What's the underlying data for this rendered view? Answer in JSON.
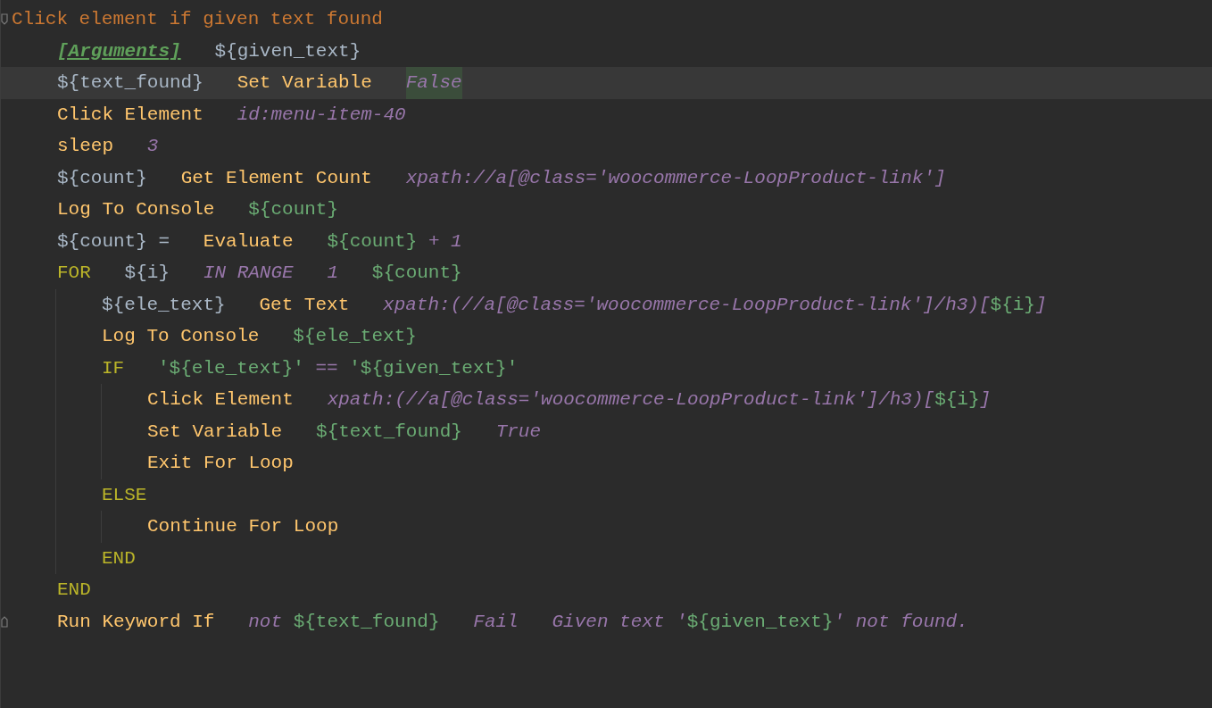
{
  "keyword": {
    "name": "Click element if given text found",
    "fold_start": true,
    "steps": [
      {
        "cells": [
          [
            {
              "kind": "setting",
              "text": "[Arguments]"
            }
          ],
          [
            {
              "kind": "variable",
              "text": "${given_text}"
            }
          ]
        ]
      },
      {
        "current": true,
        "cells": [
          [
            {
              "kind": "variable",
              "text": "${text_found}"
            }
          ],
          [
            {
              "kind": "keyword",
              "text": "Set Variable"
            }
          ],
          [
            {
              "kind": "arg",
              "text": "False",
              "highlighted": true
            }
          ]
        ]
      },
      {
        "cells": [
          [
            {
              "kind": "keyword",
              "text": "Click Element"
            }
          ],
          [
            {
              "kind": "arg",
              "text": "id:menu-item-40"
            }
          ]
        ]
      },
      {
        "cells": [
          [
            {
              "kind": "keyword",
              "text": "sleep"
            }
          ],
          [
            {
              "kind": "arg",
              "text": "3"
            }
          ]
        ]
      },
      {
        "cells": [
          [
            {
              "kind": "variable",
              "text": "${count}"
            }
          ],
          [
            {
              "kind": "keyword",
              "text": "Get Element Count"
            }
          ],
          [
            {
              "kind": "arg",
              "text": "xpath://a[@class='woocommerce-LoopProduct-link']"
            }
          ]
        ]
      },
      {
        "cells": [
          [
            {
              "kind": "keyword",
              "text": "Log To Console"
            }
          ],
          [
            {
              "kind": "var",
              "text": "${count}"
            }
          ]
        ]
      },
      {
        "cells": [
          [
            {
              "kind": "variable",
              "text": "${count} ="
            }
          ],
          [
            {
              "kind": "keyword",
              "text": "Evaluate"
            }
          ],
          [
            {
              "kind": "var",
              "text": "${count}"
            },
            {
              "kind": "arg",
              "text": " + 1"
            }
          ]
        ]
      },
      {
        "cells": [
          [
            {
              "kind": "control",
              "text": "FOR"
            }
          ],
          [
            {
              "kind": "variable",
              "text": "${i}"
            }
          ],
          [
            {
              "kind": "arg",
              "text": "IN RANGE"
            }
          ],
          [
            {
              "kind": "arg",
              "text": "1"
            }
          ],
          [
            {
              "kind": "var",
              "text": "${count}"
            }
          ]
        ],
        "children": [
          {
            "cells": [
              [
                {
                  "kind": "variable",
                  "text": "${ele_text}"
                }
              ],
              [
                {
                  "kind": "keyword",
                  "text": "Get Text"
                }
              ],
              [
                {
                  "kind": "arg",
                  "text": "xpath:(//a[@class='woocommerce-LoopProduct-link']/h3)["
                },
                {
                  "kind": "var",
                  "text": "${i}"
                },
                {
                  "kind": "arg",
                  "text": "]"
                }
              ]
            ]
          },
          {
            "cells": [
              [
                {
                  "kind": "keyword",
                  "text": "Log To Console"
                }
              ],
              [
                {
                  "kind": "var",
                  "text": "${ele_text}"
                }
              ]
            ]
          },
          {
            "cells": [
              [
                {
                  "kind": "control",
                  "text": "IF"
                }
              ],
              [
                {
                  "kind": "var",
                  "text": "'${ele_text}'"
                },
                {
                  "kind": "arg",
                  "text": " == "
                },
                {
                  "kind": "var",
                  "text": "'${given_text}'"
                }
              ]
            ],
            "children": [
              {
                "cells": [
                  [
                    {
                      "kind": "keyword",
                      "text": "Click Element"
                    }
                  ],
                  [
                    {
                      "kind": "arg",
                      "text": "xpath:(//a[@class='woocommerce-LoopProduct-link']/h3)["
                    },
                    {
                      "kind": "var",
                      "text": "${i}"
                    },
                    {
                      "kind": "arg",
                      "text": "]"
                    }
                  ]
                ]
              },
              {
                "cells": [
                  [
                    {
                      "kind": "keyword",
                      "text": "Set Variable"
                    }
                  ],
                  [
                    {
                      "kind": "var",
                      "text": "${text_found}"
                    }
                  ],
                  [
                    {
                      "kind": "arg",
                      "text": "True"
                    }
                  ]
                ]
              },
              {
                "cells": [
                  [
                    {
                      "kind": "keyword",
                      "text": "Exit For Loop"
                    }
                  ]
                ]
              }
            ]
          },
          {
            "cells": [
              [
                {
                  "kind": "control",
                  "text": "ELSE"
                }
              ]
            ],
            "children": [
              {
                "cells": [
                  [
                    {
                      "kind": "keyword",
                      "text": "Continue For Loop"
                    }
                  ]
                ]
              }
            ]
          },
          {
            "cells": [
              [
                {
                  "kind": "control",
                  "text": "END"
                }
              ]
            ]
          }
        ]
      },
      {
        "cells": [
          [
            {
              "kind": "control",
              "text": "END"
            }
          ]
        ]
      },
      {
        "fold_end": true,
        "cells": [
          [
            {
              "kind": "keyword",
              "text": "Run Keyword If"
            }
          ],
          [
            {
              "kind": "arg",
              "text": "not "
            },
            {
              "kind": "var",
              "text": "${text_found}"
            }
          ],
          [
            {
              "kind": "arg",
              "text": "Fail"
            }
          ],
          [
            {
              "kind": "arg",
              "text": "Given text '"
            },
            {
              "kind": "var",
              "text": "${given_text}"
            },
            {
              "kind": "arg",
              "text": "' not found."
            }
          ]
        ]
      }
    ]
  }
}
